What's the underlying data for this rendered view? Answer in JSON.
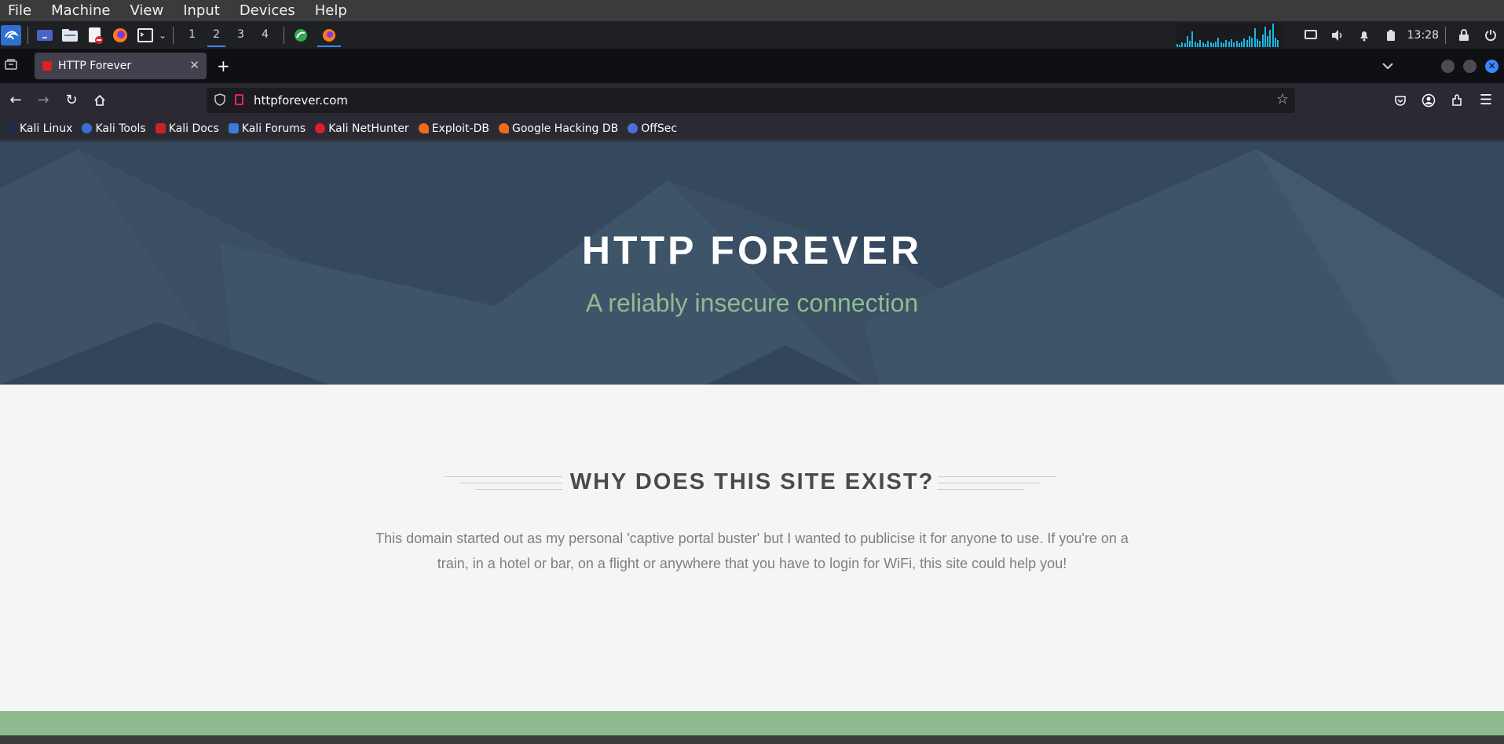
{
  "vbox_menu": [
    "File",
    "Machine",
    "View",
    "Input",
    "Devices",
    "Help"
  ],
  "panel": {
    "workspaces": [
      "1",
      "2",
      "3",
      "4"
    ],
    "clock": "13:28",
    "icons": [
      "kali-menu-icon",
      "desktop-icon",
      "files-icon",
      "text-editor-icon",
      "firefox-icon",
      "terminal-icon"
    ]
  },
  "browser": {
    "tab_title": "HTTP Forever",
    "url": "httpforever.com",
    "bookmarks": [
      "Kali Linux",
      "Kali Tools",
      "Kali Docs",
      "Kali Forums",
      "Kali NetHunter",
      "Exploit-DB",
      "Google Hacking DB",
      "OffSec"
    ]
  },
  "page": {
    "title": "HTTP FOREVER",
    "subtitle": "A reliably insecure connection",
    "section_heading": "WHY DOES THIS SITE EXIST?",
    "section_body": "This domain started out as my personal 'captive portal buster' but I wanted to publicise it for anyone to use. If you're on a train, in a hotel or bar, on a flight or anywhere that you have to login for WiFi, this site could help you!"
  },
  "colors": {
    "hero_bg": "#34495e",
    "subtitle": "#8fbc8f",
    "footer_bar": "#8fbc8f",
    "accent": "#3a88fe"
  }
}
